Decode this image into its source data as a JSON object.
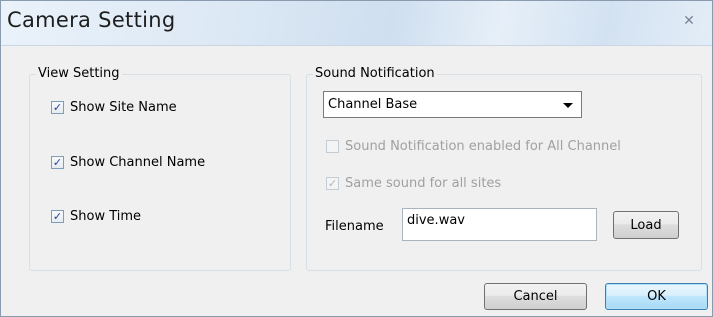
{
  "window": {
    "title": "Camera Setting",
    "close_glyph": "✕"
  },
  "view_setting": {
    "legend": "View Setting",
    "items": [
      {
        "label": "Show Site Name",
        "checked": true
      },
      {
        "label": "Show Channel Name",
        "checked": true
      },
      {
        "label": "Show Time",
        "checked": true
      }
    ]
  },
  "sound_notification": {
    "legend": "Sound Notification",
    "mode_select": {
      "value": "Channel Base"
    },
    "enabled_all_channel": {
      "label": "Sound Notification enabled for All Channel",
      "checked": false,
      "enabled": false
    },
    "same_sound_all_sites": {
      "label": "Same sound for all sites",
      "checked": true,
      "enabled": false
    },
    "filename_label": "Filename",
    "filename_value": "dive.wav",
    "load_label": "Load"
  },
  "footer": {
    "cancel_label": "Cancel",
    "ok_label": "OK"
  },
  "icons": {
    "check": "✓",
    "close": "close-icon",
    "dropdown": "chevron-down-icon"
  }
}
